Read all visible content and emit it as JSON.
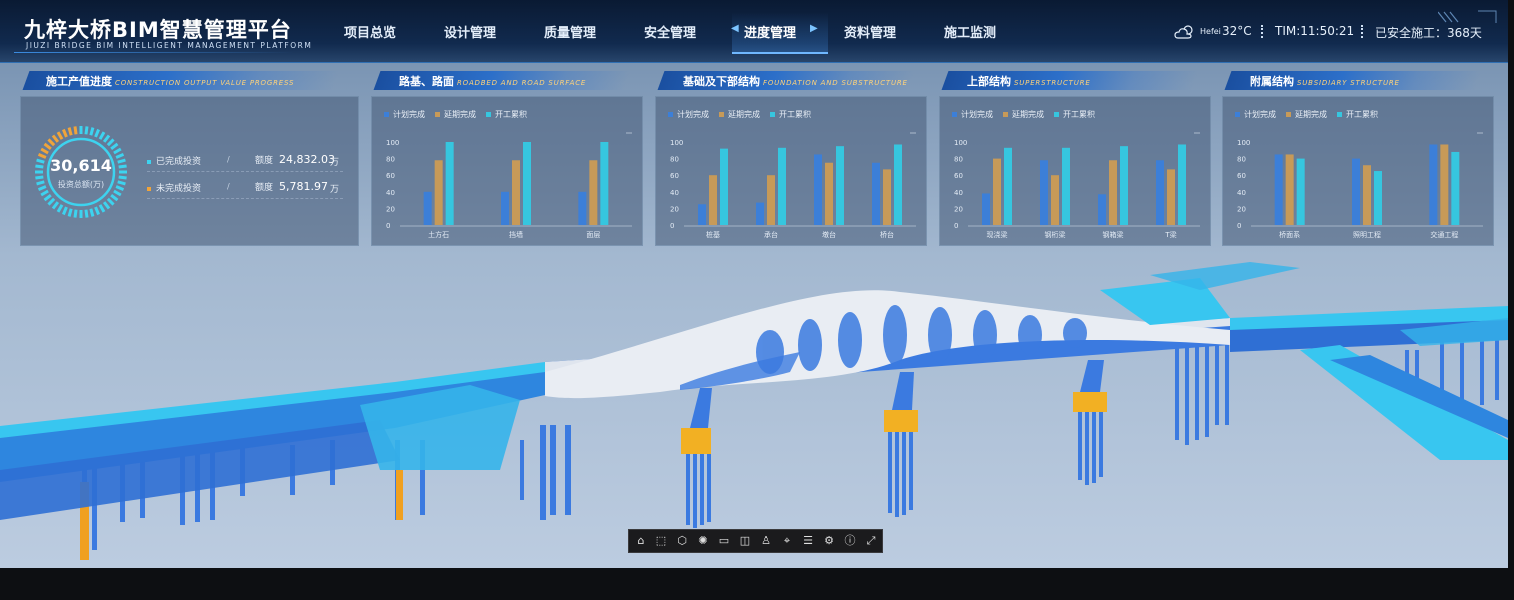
{
  "header": {
    "title": "九梓大桥BIM智慧管理平台",
    "subtitle": "JIUZI BRIDGE BIM INTELLIGENT MANAGEMENT PLATFORM",
    "nav": [
      {
        "label": "项目总览"
      },
      {
        "label": "设计管理"
      },
      {
        "label": "质量管理"
      },
      {
        "label": "安全管理"
      },
      {
        "label": "进度管理",
        "active": true
      },
      {
        "label": "资料管理"
      },
      {
        "label": "施工监测"
      }
    ],
    "weather": {
      "city": "Hefei",
      "temp": "32°C",
      "icon": "cloud-sun-icon"
    },
    "time": "TIM:11:50:21",
    "safe_days": "已安全施工：368天"
  },
  "output_panel": {
    "title": "施工产值进度",
    "title_en": "CONSTRUCTION OUTPUT VALUE PROGRESS",
    "total_value": "30,614",
    "total_label": "投资总额(万)",
    "completed_fraction": 0.81,
    "rows": [
      {
        "label": "已完成投资",
        "quota_label": "额度",
        "value": "24,832.03",
        "unit": "万",
        "color": "#3dd3ef"
      },
      {
        "label": "未完成投资",
        "quota_label": "额度",
        "value": "5,781.97",
        "unit": "万",
        "color": "#f0a43a"
      }
    ]
  },
  "colors": {
    "plan": "#3c7fd8",
    "delay": "#c79a58",
    "start": "#36c6df"
  },
  "legend": [
    "计划完成",
    "延期完成",
    "开工累积"
  ],
  "panels": [
    {
      "title": "路基、路面",
      "title_en": "ROADBED AND ROAD SURFACE"
    },
    {
      "title": "基础及下部结构",
      "title_en": "FOUNDATION AND SUBSTRUCTURE"
    },
    {
      "title": "上部结构",
      "title_en": "SUPERSTRUCTURE"
    },
    {
      "title": "附属结构",
      "title_en": "SUBSIDIARY STRUCTURE"
    }
  ],
  "chart_data": [
    {
      "type": "bar",
      "title": "路基、路面",
      "categories": [
        "土方石",
        "挡墙",
        "面层"
      ],
      "ylim": [
        0,
        100
      ],
      "yticks": [
        0,
        20,
        40,
        60,
        80,
        100
      ],
      "series": [
        {
          "name": "计划完成",
          "values": [
            40,
            40,
            40
          ]
        },
        {
          "name": "延期完成",
          "values": [
            78,
            78,
            78
          ]
        },
        {
          "name": "开工累积",
          "values": [
            100,
            100,
            100
          ]
        }
      ]
    },
    {
      "type": "bar",
      "title": "基础及下部结构",
      "categories": [
        "桩基",
        "承台",
        "墩台",
        "桥台"
      ],
      "ylim": [
        0,
        100
      ],
      "yticks": [
        0,
        20,
        40,
        60,
        80,
        100
      ],
      "series": [
        {
          "name": "计划完成",
          "values": [
            25,
            27,
            85,
            75
          ]
        },
        {
          "name": "延期完成",
          "values": [
            60,
            60,
            75,
            67
          ]
        },
        {
          "name": "开工累积",
          "values": [
            92,
            93,
            95,
            97
          ]
        }
      ]
    },
    {
      "type": "bar",
      "title": "上部结构",
      "categories": [
        "现浇梁",
        "钢桁梁",
        "钢箱梁",
        "T梁"
      ],
      "ylim": [
        0,
        100
      ],
      "yticks": [
        0,
        20,
        40,
        60,
        80,
        100
      ],
      "series": [
        {
          "name": "计划完成",
          "values": [
            38,
            78,
            37,
            78
          ]
        },
        {
          "name": "延期完成",
          "values": [
            80,
            60,
            78,
            67
          ]
        },
        {
          "name": "开工累积",
          "values": [
            93,
            93,
            95,
            97
          ]
        }
      ]
    },
    {
      "type": "bar",
      "title": "附属结构",
      "categories": [
        "桥面系",
        "照明工程",
        "交通工程"
      ],
      "ylim": [
        0,
        100
      ],
      "yticks": [
        0,
        20,
        40,
        60,
        80,
        100
      ],
      "series": [
        {
          "name": "计划完成",
          "values": [
            85,
            80,
            97
          ]
        },
        {
          "name": "延期完成",
          "values": [
            85,
            72,
            97
          ]
        },
        {
          "name": "开工累积",
          "values": [
            80,
            65,
            88
          ]
        }
      ]
    }
  ],
  "toolbar": [
    "home-icon",
    "select-icon",
    "cube-icon",
    "sun-icon",
    "measure-icon",
    "section-icon",
    "person-icon",
    "location-icon",
    "list-icon",
    "gear-icon",
    "info-icon",
    "fullscreen-icon"
  ]
}
